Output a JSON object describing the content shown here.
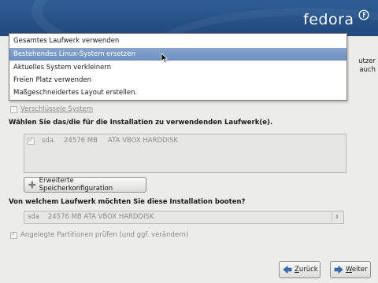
{
  "brand": {
    "wordmark": "fedora",
    "logo_icon": "fedora-infinity-icon"
  },
  "background_partial": {
    "line1": "utzer",
    "line2": "auch"
  },
  "partition_dropdown": {
    "options": [
      "Gesamtes Laufwerk verwenden",
      "Bestehendes Linux-System ersetzen",
      "Aktuelles System verkleinern",
      "Freien Platz verwenden",
      "Maßgeschneidertes Layout erstellen."
    ],
    "selected_index": 1
  },
  "encrypt": {
    "label": "Verschlüssele System",
    "checked": false,
    "enabled": false
  },
  "drives": {
    "heading": "Wählen Sie das/die für die Installation zu verwendenden Laufwerk(e).",
    "rows": [
      {
        "checked": true,
        "name": "sda",
        "size": "24576 MB",
        "model": "ATA VBOX HARDDISK"
      }
    ]
  },
  "advanced_button": {
    "label": "Erweiterte Speicherkonfiguration",
    "icon": "plus-icon"
  },
  "boot": {
    "heading": "Von welchem Laufwerk möchten Sie diese Installation booten?",
    "selected": "sda    24576 MB ATA VBOX HARDDISK"
  },
  "review": {
    "label": "Angelegte Partitionen prüfen (und ggf. verändern)",
    "checked": true,
    "enabled": false
  },
  "nav": {
    "back_label": "Zurück",
    "next_label": "Weiter",
    "back_icon": "arrow-left-icon",
    "next_icon": "arrow-right-icon"
  },
  "colors": {
    "banner": "#2d5d95",
    "selection": "#6b8fbf",
    "next_arrow": "#3a6db5",
    "back_arrow": "#3a6db5"
  }
}
